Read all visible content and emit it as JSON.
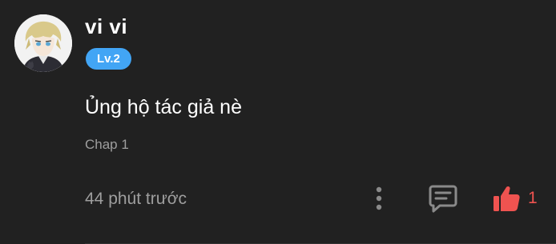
{
  "comment": {
    "username": "vi vi",
    "level": "Lv.2",
    "text": "Ủng hộ tác giả nè",
    "chapter": "Chap 1",
    "timestamp": "44 phút trước",
    "like_count": "1"
  },
  "icons": {
    "more": "more-vertical-icon",
    "reply": "comment-reply-icon",
    "like": "thumbs-up-icon"
  },
  "colors": {
    "background": "#212121",
    "level_badge": "#42a5f5",
    "like": "#ef5350",
    "muted_text": "#9e9e9e"
  }
}
